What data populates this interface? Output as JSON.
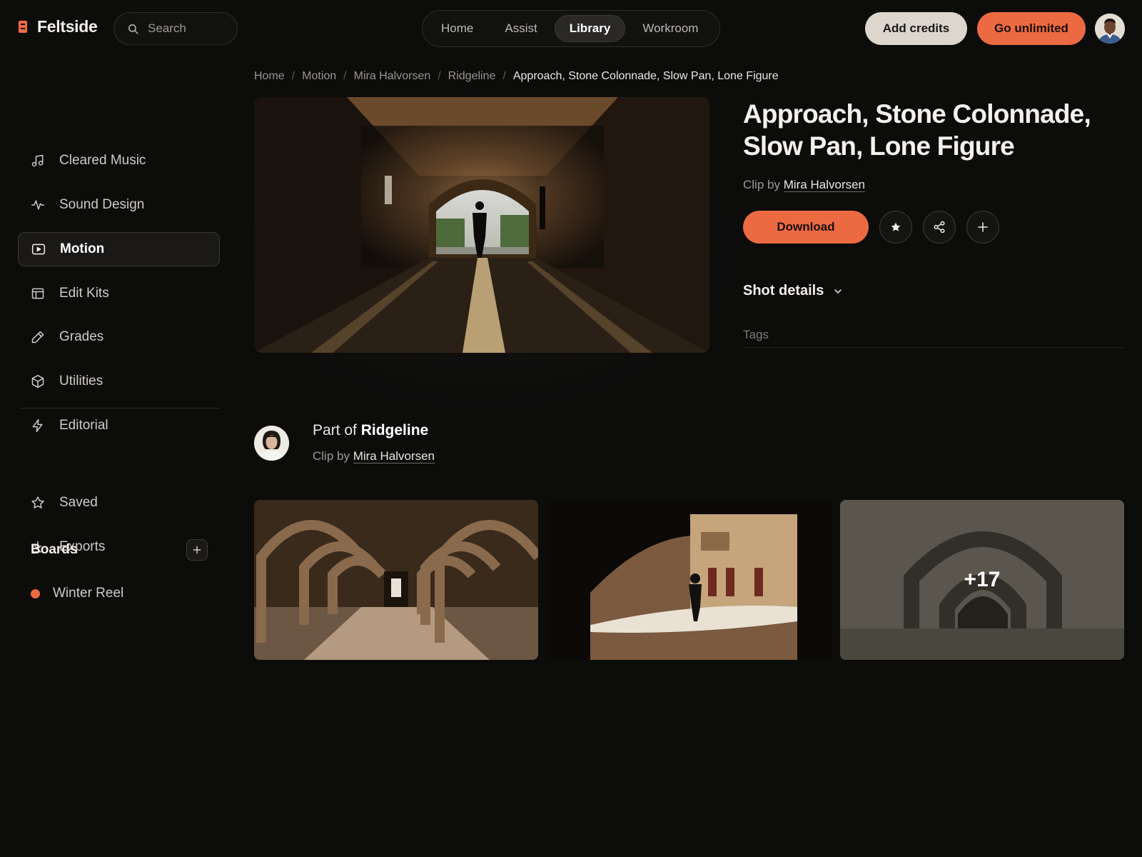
{
  "app": {
    "name": "Feltside",
    "logo_icon": "feltside-logo-mark"
  },
  "search": {
    "placeholder": "Search",
    "icon": "search-icon"
  },
  "topnav": {
    "tabs": [
      {
        "label": "Home",
        "active": false
      },
      {
        "label": "Assist",
        "active": false
      },
      {
        "label": "Library",
        "active": true
      },
      {
        "label": "Workroom",
        "active": false
      }
    ]
  },
  "header_actions": {
    "add_credits": "Add credits",
    "go_unlimited": "Go unlimited"
  },
  "colors": {
    "accent": "#ec6a42",
    "background": "#0c0c0b",
    "credits_button": "#dcd6cd"
  },
  "sidebar": {
    "items": [
      {
        "label": "Cleared Music",
        "icon": "music-note-icon"
      },
      {
        "label": "Sound Design",
        "icon": "waveform-icon"
      },
      {
        "label": "Motion",
        "icon": "video-play-icon",
        "active": true
      },
      {
        "label": "Edit Kits",
        "icon": "layout-template-icon"
      },
      {
        "label": "Grades",
        "icon": "pencil-icon"
      },
      {
        "label": "Utilities",
        "icon": "cube-icon"
      },
      {
        "label": "Editorial",
        "icon": "bolt-icon"
      }
    ],
    "secondary": [
      {
        "label": "Saved",
        "icon": "star-icon"
      },
      {
        "label": "Exports",
        "icon": "download-icon"
      }
    ],
    "boards_title": "Boards",
    "boards": [
      {
        "label": "Winter Reel",
        "color": "#ec6a42"
      }
    ]
  },
  "breadcrumb": [
    "Home",
    "Motion",
    "Mira Halvorsen",
    "Ridgeline",
    "Approach, Stone Colonnade, Slow Pan, Lone Figure"
  ],
  "clip": {
    "title": "Approach, Stone Colonnade, Slow Pan, Lone Figure",
    "byline_prefix": "Clip by",
    "author": "Mira Halvorsen",
    "download": "Download",
    "actions": [
      "star-icon",
      "share-icon",
      "plus-icon"
    ],
    "shot_details": "Shot details",
    "tags_label": "Tags"
  },
  "collection": {
    "part_of_prefix": "Part of",
    "name": "Ridgeline",
    "byline_prefix": "Clip by",
    "author": "Mira Halvorsen",
    "more_count": "+17"
  }
}
